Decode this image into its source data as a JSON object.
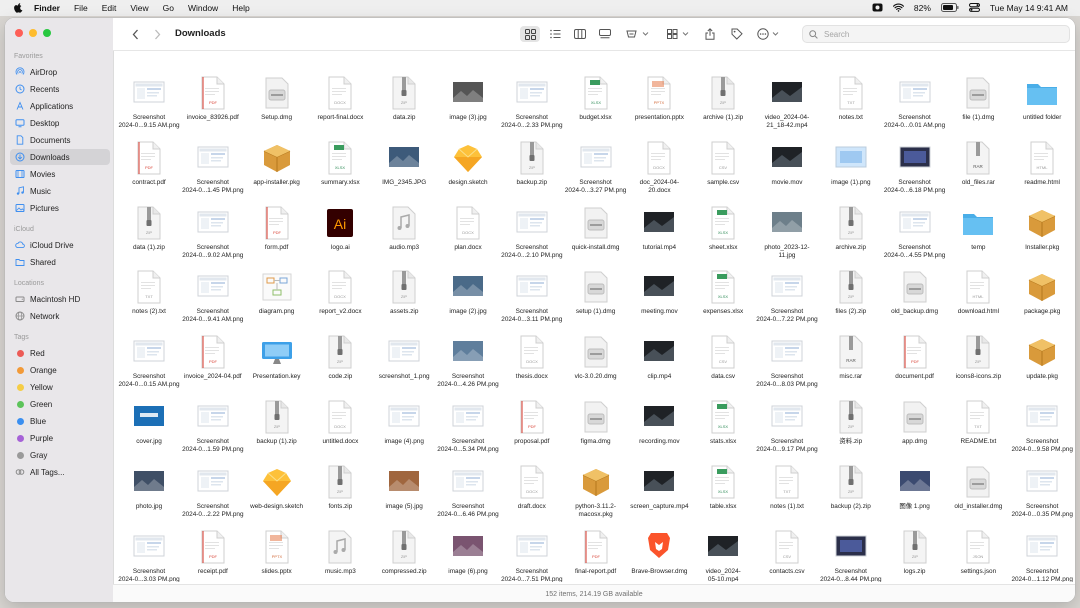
{
  "menubar": {
    "app": "Finder",
    "items": [
      "File",
      "Edit",
      "View",
      "Go",
      "Window",
      "Help"
    ],
    "battery": "82%",
    "datetime": "Tue May 14  9:41 AM"
  },
  "window": {
    "title": "Downloads"
  },
  "search": {
    "placeholder": "Search"
  },
  "sidebar": {
    "sections": [
      {
        "title": "Favorites",
        "items": [
          {
            "label": "AirDrop",
            "icon": "airdrop"
          },
          {
            "label": "Recents",
            "icon": "clock"
          },
          {
            "label": "Applications",
            "icon": "apps"
          },
          {
            "label": "Desktop",
            "icon": "desktop"
          },
          {
            "label": "Documents",
            "icon": "doc"
          },
          {
            "label": "Downloads",
            "icon": "download",
            "selected": true
          },
          {
            "label": "Movies",
            "icon": "film"
          },
          {
            "label": "Music",
            "icon": "music"
          },
          {
            "label": "Pictures",
            "icon": "photo"
          }
        ]
      },
      {
        "title": "iCloud",
        "items": [
          {
            "label": "iCloud Drive",
            "icon": "cloud"
          },
          {
            "label": "Shared",
            "icon": "shared"
          }
        ]
      },
      {
        "title": "Locations",
        "items": [
          {
            "label": "Macintosh HD",
            "icon": "disk"
          },
          {
            "label": "Network",
            "icon": "globe"
          }
        ]
      },
      {
        "title": "Tags",
        "items": [
          {
            "label": "Red",
            "color": "#ec5b56"
          },
          {
            "label": "Orange",
            "color": "#f29a38"
          },
          {
            "label": "Yellow",
            "color": "#f5cd46"
          },
          {
            "label": "Green",
            "color": "#5cc35a"
          },
          {
            "label": "Blue",
            "color": "#3b8ff0"
          },
          {
            "label": "Purple",
            "color": "#a662d7"
          },
          {
            "label": "Gray",
            "color": "#9a9a9a"
          },
          {
            "label": "All Tags...",
            "icon": "tags"
          }
        ]
      }
    ]
  },
  "files": [
    [
      {
        "n": "Screenshot\n2024-0...9.15 AM.png",
        "t": "shot"
      },
      {
        "n": "invoice_83926.pdf",
        "t": "pdf"
      },
      {
        "n": "Setup.dmg",
        "t": "dmg"
      },
      {
        "n": "report-final.docx",
        "t": "docx"
      },
      {
        "n": "data.zip",
        "t": "zip"
      },
      {
        "n": "image (3).jpg",
        "t": "photo",
        "c": "#555"
      },
      {
        "n": "Screenshot\n2024-0...2.33 PM.png",
        "t": "shot"
      },
      {
        "n": "budget.xlsx",
        "t": "xlsx"
      },
      {
        "n": "presentation.pptx",
        "t": "pptx"
      },
      {
        "n": "archive (1).zip",
        "t": "zip"
      },
      {
        "n": "video_2024-04-\n21_18-42.mp4",
        "t": "video"
      },
      {
        "n": "notes.txt",
        "t": "txt"
      },
      {
        "n": "Screenshot\n2024-0...0.01 AM.png",
        "t": "shot"
      },
      {
        "n": "file (1).dmg",
        "t": "dmg"
      },
      {
        "n": "untitled folder",
        "t": "folder"
      }
    ],
    [
      {
        "n": "contract.pdf",
        "t": "pdf"
      },
      {
        "n": "Screenshot\n2024-0...1.45 PM.png",
        "t": "shot"
      },
      {
        "n": "app-installer.pkg",
        "t": "pkg"
      },
      {
        "n": "summary.xlsx",
        "t": "xlsx"
      },
      {
        "n": "IMG_2345.JPG",
        "t": "photo",
        "c": "#3d5a7a"
      },
      {
        "n": "design.sketch",
        "t": "sketch"
      },
      {
        "n": "backup.zip",
        "t": "zip"
      },
      {
        "n": "Screenshot\n2024-0...3.27 PM.png",
        "t": "shot"
      },
      {
        "n": "doc_2024-04-\n20.docx",
        "t": "docx"
      },
      {
        "n": "sample.csv",
        "t": "csv"
      },
      {
        "n": "movie.mov",
        "t": "video"
      },
      {
        "n": "image (1).png",
        "t": "png"
      },
      {
        "n": "Screenshot\n2024-0...6.18 PM.png",
        "t": "shotdark"
      },
      {
        "n": "old_files.rar",
        "t": "rar"
      },
      {
        "n": "readme.html",
        "t": "html"
      }
    ],
    [
      {
        "n": "data (1).zip",
        "t": "zip"
      },
      {
        "n": "Screenshot\n2024-0...9.02 AM.png",
        "t": "shot"
      },
      {
        "n": "form.pdf",
        "t": "pdf"
      },
      {
        "n": "logo.ai",
        "t": "ai"
      },
      {
        "n": "audio.mp3",
        "t": "mp3"
      },
      {
        "n": "plan.docx",
        "t": "docx"
      },
      {
        "n": "Screenshot\n2024-0...2.10 PM.png",
        "t": "shot"
      },
      {
        "n": "quick-install.dmg",
        "t": "dmg"
      },
      {
        "n": "tutorial.mp4",
        "t": "video"
      },
      {
        "n": "sheet.xlsx",
        "t": "xlsx"
      },
      {
        "n": "photo_2023-12-\n11.jpg",
        "t": "photo",
        "c": "#6d7f8a"
      },
      {
        "n": "archive.zip",
        "t": "zip"
      },
      {
        "n": "Screenshot\n2024-0...4.55 PM.png",
        "t": "shot"
      },
      {
        "n": "temp",
        "t": "folder"
      },
      {
        "n": "Installer.pkg",
        "t": "pkg"
      }
    ],
    [
      {
        "n": "notes (2).txt",
        "t": "txt"
      },
      {
        "n": "Screenshot\n2024-0...9.41 AM.png",
        "t": "shot"
      },
      {
        "n": "diagram.png",
        "t": "diagram"
      },
      {
        "n": "report_v2.docx",
        "t": "docx"
      },
      {
        "n": "assets.zip",
        "t": "zip"
      },
      {
        "n": "image (2).jpg",
        "t": "photo",
        "c": "#4a6a88"
      },
      {
        "n": "Screenshot\n2024-0...3.11 PM.png",
        "t": "shot"
      },
      {
        "n": "setup (1).dmg",
        "t": "dmg"
      },
      {
        "n": "meeting.mov",
        "t": "video"
      },
      {
        "n": "expenses.xlsx",
        "t": "xlsx"
      },
      {
        "n": "Screenshot\n2024-0...7.22 PM.png",
        "t": "shot"
      },
      {
        "n": "files (2).zip",
        "t": "zip"
      },
      {
        "n": "old_backup.dmg",
        "t": "dmg"
      },
      {
        "n": "download.html",
        "t": "html"
      },
      {
        "n": "package.pkg",
        "t": "pkg"
      }
    ],
    [
      {
        "n": "Screenshot\n2024-0...0.15 AM.png",
        "t": "shot"
      },
      {
        "n": "invoice_2024-04.pdf",
        "t": "pdf"
      },
      {
        "n": "Presentation.key",
        "t": "key"
      },
      {
        "n": "code.zip",
        "t": "zip"
      },
      {
        "n": "screenshot_1.png",
        "t": "shot"
      },
      {
        "n": "Screenshot\n2024-0...4.26 PM.png",
        "t": "photo",
        "c": "#5f7e9c"
      },
      {
        "n": "thesis.docx",
        "t": "docx"
      },
      {
        "n": "vlc-3.0.20.dmg",
        "t": "dmg"
      },
      {
        "n": "clip.mp4",
        "t": "video"
      },
      {
        "n": "data.csv",
        "t": "csv"
      },
      {
        "n": "Screenshot\n2024-0...8.03 PM.png",
        "t": "shot"
      },
      {
        "n": "misc.rar",
        "t": "rar"
      },
      {
        "n": "document.pdf",
        "t": "pdf"
      },
      {
        "n": "icons8-icons.zip",
        "t": "zip"
      },
      {
        "n": "update.pkg",
        "t": "pkg"
      }
    ],
    [
      {
        "n": "cover.jpg",
        "t": "cover"
      },
      {
        "n": "Screenshot\n2024-0...1.59 PM.png",
        "t": "shot"
      },
      {
        "n": "backup (1).zip",
        "t": "zip"
      },
      {
        "n": "untitled.docx",
        "t": "docx"
      },
      {
        "n": "image (4).png",
        "t": "shot"
      },
      {
        "n": "Screenshot\n2024-0...5.34 PM.png",
        "t": "shot"
      },
      {
        "n": "proposal.pdf",
        "t": "pdf"
      },
      {
        "n": "figma.dmg",
        "t": "dmg"
      },
      {
        "n": "recording.mov",
        "t": "video"
      },
      {
        "n": "stats.xlsx",
        "t": "xlsx"
      },
      {
        "n": "Screenshot\n2024-0...9.17 PM.png",
        "t": "shot"
      },
      {
        "n": "资料.zip",
        "t": "zip"
      },
      {
        "n": "app.dmg",
        "t": "dmg"
      },
      {
        "n": "README.txt",
        "t": "txt"
      },
      {
        "n": "Screenshot\n2024-0...9.58 PM.png",
        "t": "shot"
      }
    ],
    [
      {
        "n": "photo.jpg",
        "t": "photo",
        "c": "#3f4f66"
      },
      {
        "n": "Screenshot\n2024-0...2.22 PM.png",
        "t": "shot"
      },
      {
        "n": "web-design.sketch",
        "t": "sketch"
      },
      {
        "n": "fonts.zip",
        "t": "zip"
      },
      {
        "n": "image (5).jpg",
        "t": "photo",
        "c": "#a0663e"
      },
      {
        "n": "Screenshot\n2024-0...6.46 PM.png",
        "t": "shot"
      },
      {
        "n": "draft.docx",
        "t": "docx"
      },
      {
        "n": "python-3.11.2-\nmacosx.pkg",
        "t": "pkg"
      },
      {
        "n": "screen_capture.mp4",
        "t": "video"
      },
      {
        "n": "table.xlsx",
        "t": "xlsx"
      },
      {
        "n": "notes (1).txt",
        "t": "txt"
      },
      {
        "n": "backup (2).zip",
        "t": "zip"
      },
      {
        "n": "图像 1.png",
        "t": "photo",
        "c": "#3b4a70"
      },
      {
        "n": "old_installer.dmg",
        "t": "dmg"
      },
      {
        "n": "Screenshot\n2024-0...0.35 PM.png",
        "t": "shot"
      }
    ],
    [
      {
        "n": "Screenshot\n2024-0...3.03 PM.png",
        "t": "shot"
      },
      {
        "n": "receipt.pdf",
        "t": "pdf"
      },
      {
        "n": "slides.pptx",
        "t": "pptx"
      },
      {
        "n": "music.mp3",
        "t": "mp3"
      },
      {
        "n": "compressed.zip",
        "t": "zip"
      },
      {
        "n": "image (6).png",
        "t": "photo",
        "c": "#7a5470"
      },
      {
        "n": "Screenshot\n2024-0...7.51 PM.png",
        "t": "shot"
      },
      {
        "n": "final-report.pdf",
        "t": "pdf"
      },
      {
        "n": "Brave-Browser.dmg",
        "t": "brave"
      },
      {
        "n": "video_2024-\n05-10.mp4",
        "t": "video"
      },
      {
        "n": "contacts.csv",
        "t": "csv"
      },
      {
        "n": "Screenshot\n2024-0...8.44 PM.png",
        "t": "shotdark"
      },
      {
        "n": "logs.zip",
        "t": "zip"
      },
      {
        "n": "settings.json",
        "t": "json"
      },
      {
        "n": "Screenshot\n2024-0...1.12 PM.png",
        "t": "shot"
      }
    ]
  ],
  "status": "152 items, 214.19 GB available",
  "colors": {
    "folder": "#4aaee8",
    "selection": "#d4d3d6",
    "traffic_close": "#fe5f57",
    "traffic_min": "#febc2e",
    "traffic_max": "#28c840"
  }
}
